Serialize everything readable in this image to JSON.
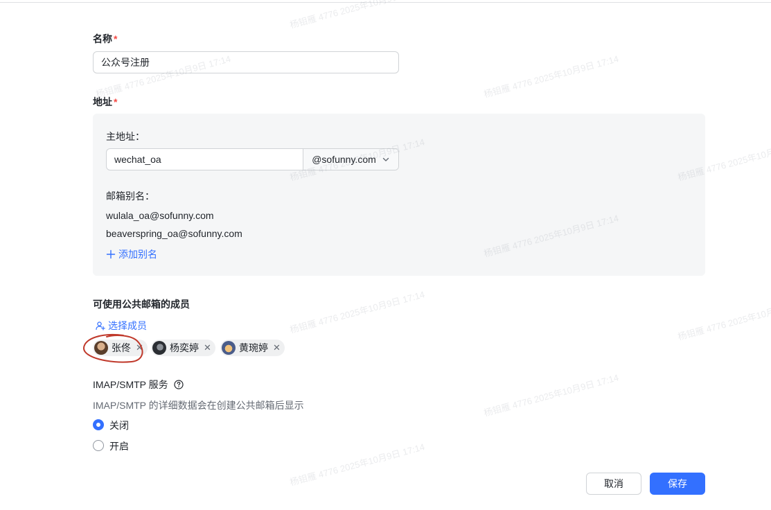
{
  "form": {
    "name_label": "名称",
    "required_mark": "*",
    "name_value": "公众号注册",
    "address_label": "地址",
    "main_address_label": "主地址：",
    "main_address_local": "wechat_oa",
    "main_address_domain": "@sofunny.com",
    "alias_label": "邮箱别名：",
    "aliases": [
      "wulala_oa@sofunny.com",
      "beaverspring_oa@sofunny.com"
    ],
    "add_alias_label": "添加别名",
    "members_label": "可使用公共邮箱的成员",
    "select_members_label": "选择成员",
    "members": [
      {
        "name": "张佟"
      },
      {
        "name": "杨奕婷"
      },
      {
        "name": "黄琬婷"
      }
    ],
    "imap_label": "IMAP/SMTP 服务",
    "imap_hint": "IMAP/SMTP 的详细数据会在创建公共邮箱后显示",
    "imap_options": [
      {
        "label": "关闭",
        "checked": true
      },
      {
        "label": "开启",
        "checked": false
      }
    ]
  },
  "footer": {
    "cancel_label": "取消",
    "save_label": "保存"
  },
  "watermark_text": "杨钼雁 4776 2025年10月9日 17:14",
  "colors": {
    "accent": "#3370ff",
    "required": "#f54a45",
    "annotation": "#c0392b"
  }
}
